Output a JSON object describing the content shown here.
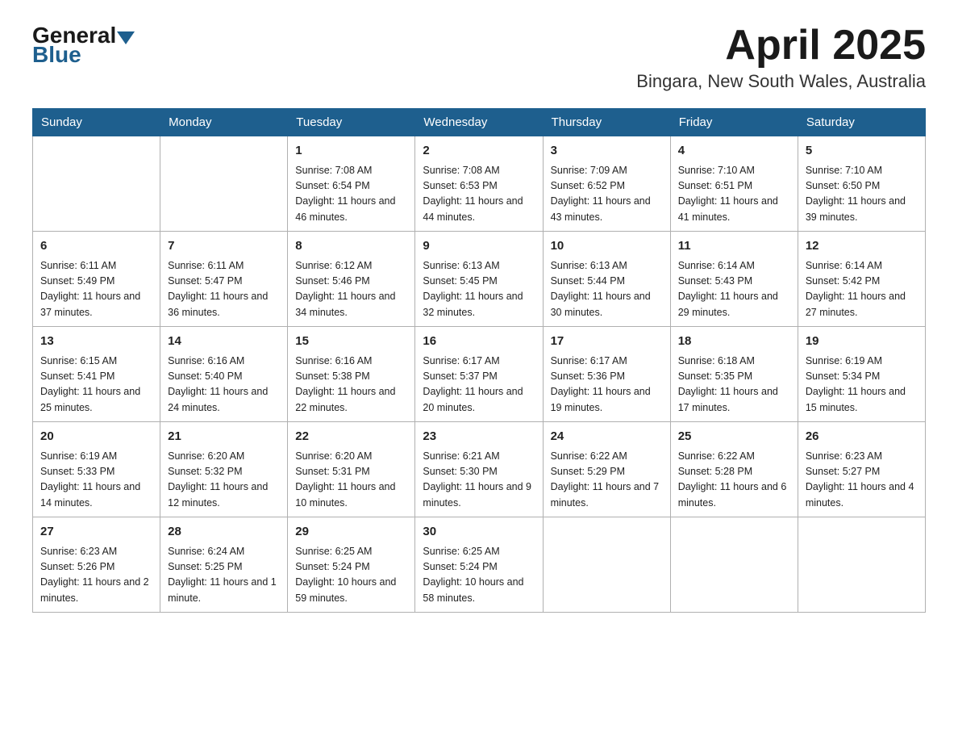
{
  "header": {
    "logo_general": "General",
    "logo_blue": "Blue",
    "month_title": "April 2025",
    "location": "Bingara, New South Wales, Australia"
  },
  "weekdays": [
    "Sunday",
    "Monday",
    "Tuesday",
    "Wednesday",
    "Thursday",
    "Friday",
    "Saturday"
  ],
  "weeks": [
    [
      {
        "day": "",
        "sunrise": "",
        "sunset": "",
        "daylight": ""
      },
      {
        "day": "",
        "sunrise": "",
        "sunset": "",
        "daylight": ""
      },
      {
        "day": "1",
        "sunrise": "Sunrise: 7:08 AM",
        "sunset": "Sunset: 6:54 PM",
        "daylight": "Daylight: 11 hours and 46 minutes."
      },
      {
        "day": "2",
        "sunrise": "Sunrise: 7:08 AM",
        "sunset": "Sunset: 6:53 PM",
        "daylight": "Daylight: 11 hours and 44 minutes."
      },
      {
        "day": "3",
        "sunrise": "Sunrise: 7:09 AM",
        "sunset": "Sunset: 6:52 PM",
        "daylight": "Daylight: 11 hours and 43 minutes."
      },
      {
        "day": "4",
        "sunrise": "Sunrise: 7:10 AM",
        "sunset": "Sunset: 6:51 PM",
        "daylight": "Daylight: 11 hours and 41 minutes."
      },
      {
        "day": "5",
        "sunrise": "Sunrise: 7:10 AM",
        "sunset": "Sunset: 6:50 PM",
        "daylight": "Daylight: 11 hours and 39 minutes."
      }
    ],
    [
      {
        "day": "6",
        "sunrise": "Sunrise: 6:11 AM",
        "sunset": "Sunset: 5:49 PM",
        "daylight": "Daylight: 11 hours and 37 minutes."
      },
      {
        "day": "7",
        "sunrise": "Sunrise: 6:11 AM",
        "sunset": "Sunset: 5:47 PM",
        "daylight": "Daylight: 11 hours and 36 minutes."
      },
      {
        "day": "8",
        "sunrise": "Sunrise: 6:12 AM",
        "sunset": "Sunset: 5:46 PM",
        "daylight": "Daylight: 11 hours and 34 minutes."
      },
      {
        "day": "9",
        "sunrise": "Sunrise: 6:13 AM",
        "sunset": "Sunset: 5:45 PM",
        "daylight": "Daylight: 11 hours and 32 minutes."
      },
      {
        "day": "10",
        "sunrise": "Sunrise: 6:13 AM",
        "sunset": "Sunset: 5:44 PM",
        "daylight": "Daylight: 11 hours and 30 minutes."
      },
      {
        "day": "11",
        "sunrise": "Sunrise: 6:14 AM",
        "sunset": "Sunset: 5:43 PM",
        "daylight": "Daylight: 11 hours and 29 minutes."
      },
      {
        "day": "12",
        "sunrise": "Sunrise: 6:14 AM",
        "sunset": "Sunset: 5:42 PM",
        "daylight": "Daylight: 11 hours and 27 minutes."
      }
    ],
    [
      {
        "day": "13",
        "sunrise": "Sunrise: 6:15 AM",
        "sunset": "Sunset: 5:41 PM",
        "daylight": "Daylight: 11 hours and 25 minutes."
      },
      {
        "day": "14",
        "sunrise": "Sunrise: 6:16 AM",
        "sunset": "Sunset: 5:40 PM",
        "daylight": "Daylight: 11 hours and 24 minutes."
      },
      {
        "day": "15",
        "sunrise": "Sunrise: 6:16 AM",
        "sunset": "Sunset: 5:38 PM",
        "daylight": "Daylight: 11 hours and 22 minutes."
      },
      {
        "day": "16",
        "sunrise": "Sunrise: 6:17 AM",
        "sunset": "Sunset: 5:37 PM",
        "daylight": "Daylight: 11 hours and 20 minutes."
      },
      {
        "day": "17",
        "sunrise": "Sunrise: 6:17 AM",
        "sunset": "Sunset: 5:36 PM",
        "daylight": "Daylight: 11 hours and 19 minutes."
      },
      {
        "day": "18",
        "sunrise": "Sunrise: 6:18 AM",
        "sunset": "Sunset: 5:35 PM",
        "daylight": "Daylight: 11 hours and 17 minutes."
      },
      {
        "day": "19",
        "sunrise": "Sunrise: 6:19 AM",
        "sunset": "Sunset: 5:34 PM",
        "daylight": "Daylight: 11 hours and 15 minutes."
      }
    ],
    [
      {
        "day": "20",
        "sunrise": "Sunrise: 6:19 AM",
        "sunset": "Sunset: 5:33 PM",
        "daylight": "Daylight: 11 hours and 14 minutes."
      },
      {
        "day": "21",
        "sunrise": "Sunrise: 6:20 AM",
        "sunset": "Sunset: 5:32 PM",
        "daylight": "Daylight: 11 hours and 12 minutes."
      },
      {
        "day": "22",
        "sunrise": "Sunrise: 6:20 AM",
        "sunset": "Sunset: 5:31 PM",
        "daylight": "Daylight: 11 hours and 10 minutes."
      },
      {
        "day": "23",
        "sunrise": "Sunrise: 6:21 AM",
        "sunset": "Sunset: 5:30 PM",
        "daylight": "Daylight: 11 hours and 9 minutes."
      },
      {
        "day": "24",
        "sunrise": "Sunrise: 6:22 AM",
        "sunset": "Sunset: 5:29 PM",
        "daylight": "Daylight: 11 hours and 7 minutes."
      },
      {
        "day": "25",
        "sunrise": "Sunrise: 6:22 AM",
        "sunset": "Sunset: 5:28 PM",
        "daylight": "Daylight: 11 hours and 6 minutes."
      },
      {
        "day": "26",
        "sunrise": "Sunrise: 6:23 AM",
        "sunset": "Sunset: 5:27 PM",
        "daylight": "Daylight: 11 hours and 4 minutes."
      }
    ],
    [
      {
        "day": "27",
        "sunrise": "Sunrise: 6:23 AM",
        "sunset": "Sunset: 5:26 PM",
        "daylight": "Daylight: 11 hours and 2 minutes."
      },
      {
        "day": "28",
        "sunrise": "Sunrise: 6:24 AM",
        "sunset": "Sunset: 5:25 PM",
        "daylight": "Daylight: 11 hours and 1 minute."
      },
      {
        "day": "29",
        "sunrise": "Sunrise: 6:25 AM",
        "sunset": "Sunset: 5:24 PM",
        "daylight": "Daylight: 10 hours and 59 minutes."
      },
      {
        "day": "30",
        "sunrise": "Sunrise: 6:25 AM",
        "sunset": "Sunset: 5:24 PM",
        "daylight": "Daylight: 10 hours and 58 minutes."
      },
      {
        "day": "",
        "sunrise": "",
        "sunset": "",
        "daylight": ""
      },
      {
        "day": "",
        "sunrise": "",
        "sunset": "",
        "daylight": ""
      },
      {
        "day": "",
        "sunrise": "",
        "sunset": "",
        "daylight": ""
      }
    ]
  ]
}
